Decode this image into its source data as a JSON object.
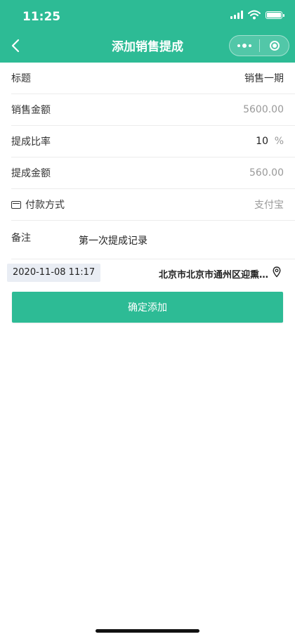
{
  "status_bar": {
    "time": "11:25"
  },
  "nav": {
    "title": "添加销售提成"
  },
  "form": {
    "title_row": {
      "label": "标题",
      "value": "销售一期"
    },
    "sales_amount_row": {
      "label": "销售金额",
      "value": "5600.00"
    },
    "rate_row": {
      "label": "提成比率",
      "value": "10",
      "unit": "%"
    },
    "commission_row": {
      "label": "提成金额",
      "value": "560.00"
    },
    "payment_row": {
      "label": "付款方式",
      "value": "支付宝"
    },
    "remark_row": {
      "label": "备注",
      "value": "第一次提成记录"
    }
  },
  "info": {
    "datetime": "2020-11-08 11:17",
    "address": "北京市北京市通州区迎熏…"
  },
  "submit_label": "确定添加",
  "colors": {
    "primary": "#2dbb95",
    "date_bg": "#e9edf4"
  },
  "icons": [
    "back-icon",
    "more-icon",
    "close-capsule-icon",
    "wallet-icon",
    "location-pin-icon",
    "signal-icon",
    "wifi-icon",
    "battery-icon"
  ]
}
